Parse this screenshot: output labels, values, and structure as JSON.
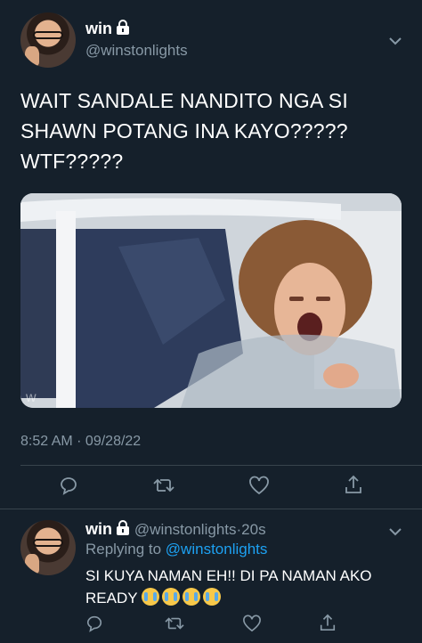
{
  "tweet": {
    "display_name": "win",
    "handle": "@winstonlights",
    "text": "WAIT SANDALE NANDITO NGA SI SHAWN POTANG INA KAYO????? WTF?????",
    "timestamp": "8:52 AM · 09/28/22",
    "media_watermark": "w",
    "icons": [
      "lock-icon",
      "chevron-down-icon",
      "reply-icon",
      "retweet-icon",
      "like-icon",
      "share-icon"
    ]
  },
  "reply": {
    "display_name": "win",
    "handle": "@winstonlights",
    "separator": "·",
    "time": "20s",
    "replying_prefix": "Replying to",
    "replying_handle": "@winstonlights",
    "text": "SI KUYA NAMAN EH!! DI PA NAMAN AKO READY",
    "emoji_names": [
      "loudly-crying-face",
      "loudly-crying-face",
      "loudly-crying-face",
      "loudly-crying-face"
    ]
  },
  "colors": {
    "background": "#15202b",
    "secondary_text": "#8899a6",
    "link": "#1da1f2",
    "divider": "#38444d"
  }
}
